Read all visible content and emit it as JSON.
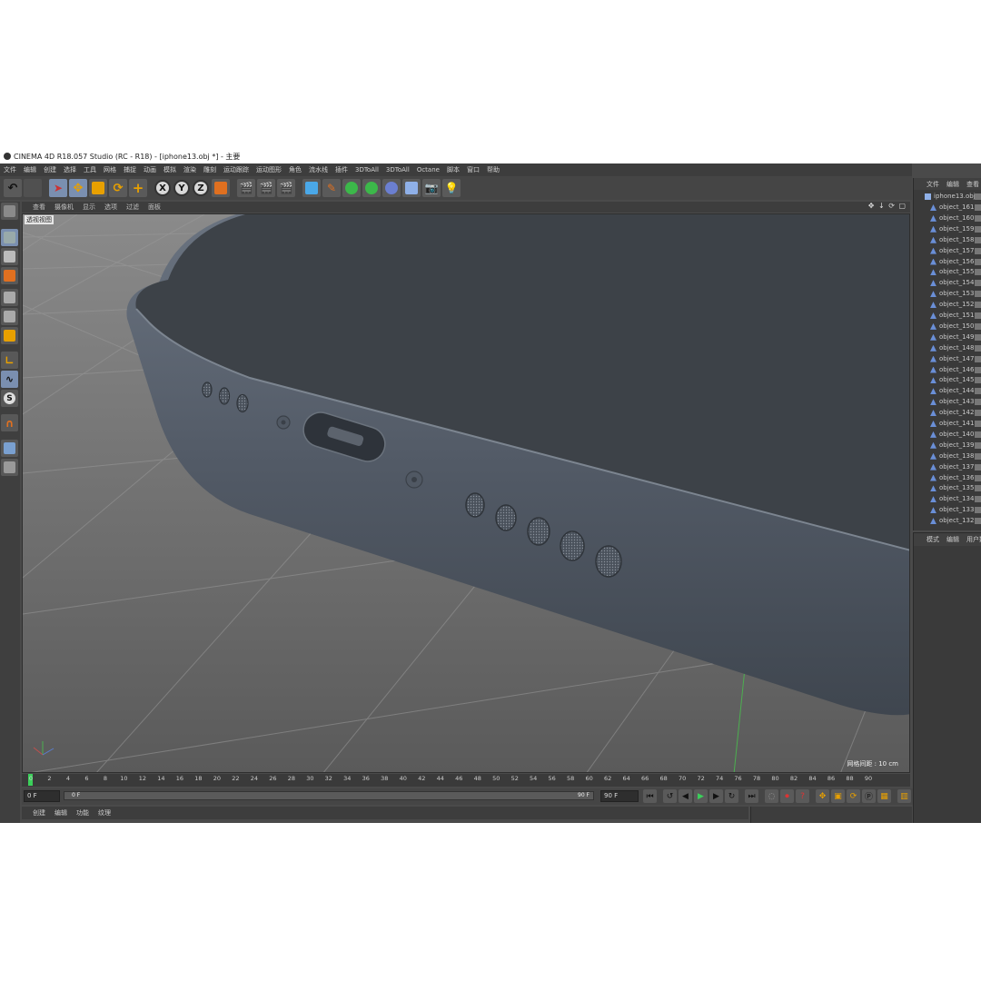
{
  "window": {
    "title": "CINEMA 4D R18.057 Studio (RC - R18) - [iphone13.obj *] - 主要"
  },
  "menu": [
    "文件",
    "编辑",
    "创建",
    "选择",
    "工具",
    "网格",
    "捕捉",
    "动画",
    "模拟",
    "渲染",
    "雕刻",
    "运动跟踪",
    "运动图形",
    "角色",
    "流水线",
    "插件",
    "3DToAll",
    "3DToAll",
    "Octane",
    "脚本",
    "窗口",
    "帮助"
  ],
  "toolbar": {
    "undo_icon": "undo-icon",
    "axis_x": "X",
    "axis_y": "Y",
    "axis_z": "Z"
  },
  "viewport": {
    "menu": [
      "查看",
      "摄像机",
      "显示",
      "选项",
      "过滤",
      "面板"
    ],
    "label": "透视视图",
    "grid_distance": "网格间距 : 10 cm"
  },
  "timeline": {
    "ticks": [
      "0",
      "2",
      "4",
      "6",
      "8",
      "10",
      "12",
      "14",
      "16",
      "18",
      "20",
      "22",
      "24",
      "26",
      "28",
      "30",
      "32",
      "34",
      "36",
      "38",
      "40",
      "42",
      "44",
      "46",
      "48",
      "50",
      "52",
      "54",
      "56",
      "58",
      "60",
      "62",
      "64",
      "66",
      "68",
      "70",
      "72",
      "74",
      "76",
      "78",
      "80",
      "82",
      "84",
      "86",
      "88",
      "90"
    ],
    "current_frame_field": "0 F",
    "end_frame_field": "0 F",
    "range_start": "0 F",
    "range_start_left": "0 F",
    "range_end": "90 F",
    "range_end_field": "90 F"
  },
  "bottom_menu": [
    "创建",
    "编辑",
    "功能",
    "纹理"
  ],
  "objects_panel": {
    "menu": [
      "文件",
      "编辑",
      "查看"
    ],
    "root": "iphone13.obj",
    "items": [
      "object_161",
      "object_160",
      "object_159",
      "object_158",
      "object_157",
      "object_156",
      "object_155",
      "object_154",
      "object_153",
      "object_152",
      "object_151",
      "object_150",
      "object_149",
      "object_148",
      "object_147",
      "object_146",
      "object_145",
      "object_144",
      "object_143",
      "object_142",
      "object_141",
      "object_140",
      "object_139",
      "object_138",
      "object_137",
      "object_136",
      "object_135",
      "object_134",
      "object_133",
      "object_132"
    ]
  },
  "attributes_panel": {
    "menu": [
      "模式",
      "编辑",
      "用户数"
    ]
  },
  "colors": {
    "accent": "#7a8fb0",
    "phone_body": "#5b6470",
    "phone_screen": "#3d4248",
    "playhead": "#3bd05a"
  }
}
